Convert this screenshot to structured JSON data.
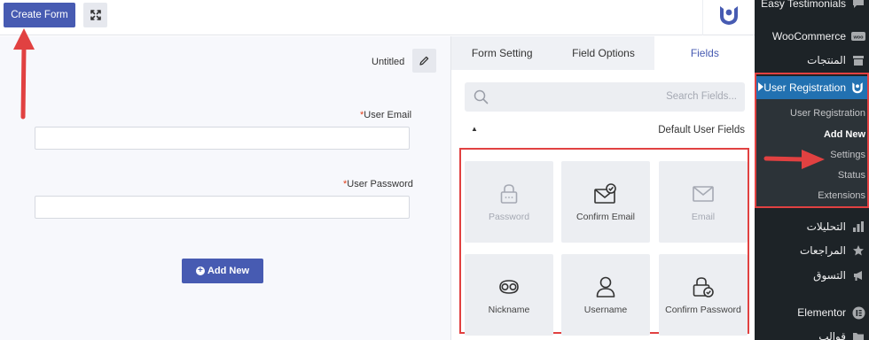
{
  "toolbar": {
    "create_form_label": "Create Form",
    "expand_icon": "expand-arrows-icon",
    "brand_logo": "user-registration-logo"
  },
  "canvas": {
    "form_title": "Untitled",
    "edit_icon": "pencil-icon",
    "fields": [
      {
        "required_mark": "*",
        "label": "User Email"
      },
      {
        "required_mark": "*",
        "label": "User Password"
      }
    ],
    "add_new_label": "Add New"
  },
  "panel": {
    "tabs": [
      {
        "label": "Form Setting",
        "active": false
      },
      {
        "label": "Field Options",
        "active": false
      },
      {
        "label": "Fields",
        "active": true
      }
    ],
    "search_placeholder": "Search Fields...",
    "section_title": "Default User Fields",
    "field_cards": [
      {
        "label": "Password",
        "icon": "lock-icon",
        "enabled": false
      },
      {
        "label": "Confirm Email",
        "icon": "envelope-check-icon",
        "enabled": true
      },
      {
        "label": "Email",
        "icon": "envelope-icon",
        "enabled": false
      },
      {
        "label": "Nickname",
        "icon": "mask-icon",
        "enabled": true
      },
      {
        "label": "Username",
        "icon": "user-icon",
        "enabled": true
      },
      {
        "label": "Confirm Password",
        "icon": "lock-check-icon",
        "enabled": true
      }
    ]
  },
  "wp_sidebar": {
    "items_top": [
      {
        "label": "Easy Testimonials",
        "icon": "testimonial-icon"
      },
      {
        "label": "WooCommerce",
        "icon": "woo-icon"
      },
      {
        "label": "المنتجات",
        "icon": "archive-icon"
      }
    ],
    "active_menu": {
      "label": "User Registration",
      "icon": "user-registration-logo",
      "submenu": [
        {
          "label": "User Registration",
          "current": false
        },
        {
          "label": "Add New",
          "current": true
        },
        {
          "label": "Settings",
          "current": false
        },
        {
          "label": "Status",
          "current": false
        },
        {
          "label": "Extensions",
          "current": false
        }
      ]
    },
    "items_bottom": [
      {
        "label": "التحليلات",
        "icon": "chart-icon"
      },
      {
        "label": "المراجعات",
        "icon": "star-icon"
      },
      {
        "label": "التسوق",
        "icon": "megaphone-icon"
      },
      {
        "label": "Elementor",
        "icon": "elementor-icon"
      },
      {
        "label": "قوالب",
        "icon": "folder-icon"
      }
    ]
  },
  "colors": {
    "accent": "#475bb2",
    "annotation_red": "#e14141",
    "wp_sidebar_bg": "#1d2327",
    "wp_active_bg": "#2271b1"
  }
}
